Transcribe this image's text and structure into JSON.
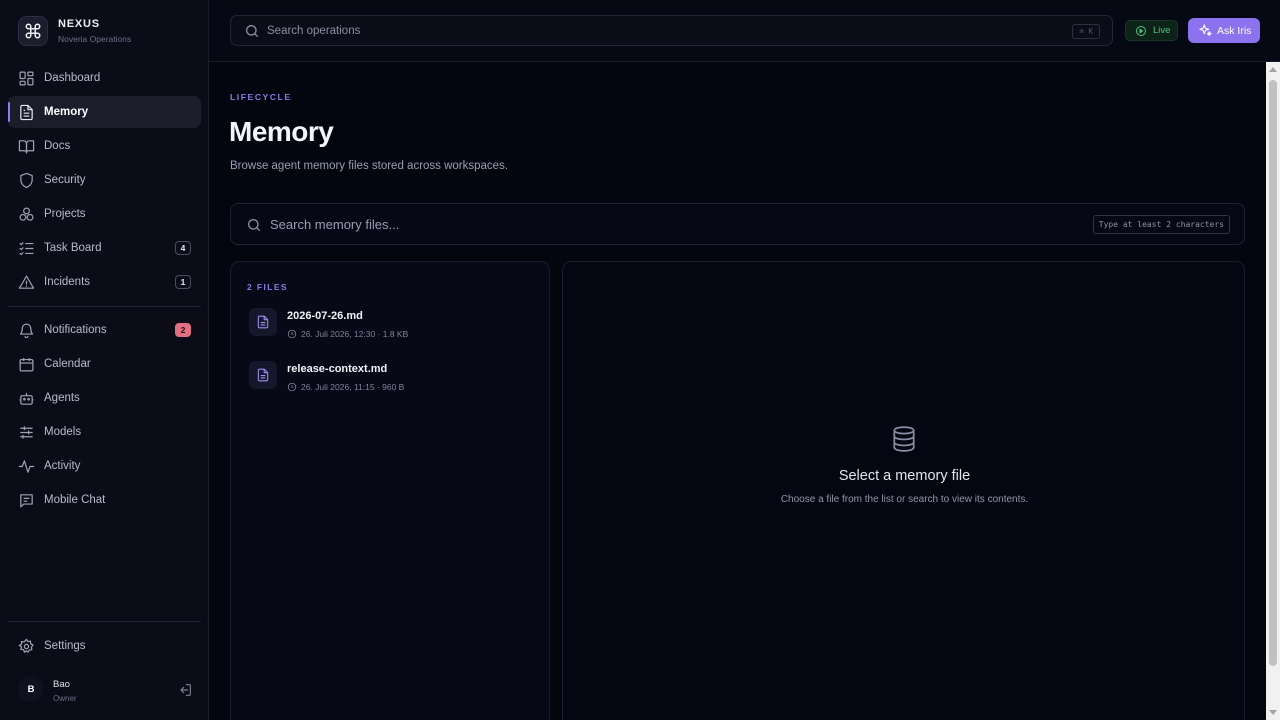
{
  "brand": {
    "name": "NEXUS",
    "subtitle": "Noveria Operations"
  },
  "nav": {
    "items": [
      {
        "label": "Dashboard",
        "icon": "dashboard-icon"
      },
      {
        "label": "Memory",
        "icon": "document-icon",
        "active": true
      },
      {
        "label": "Docs",
        "icon": "book-icon"
      },
      {
        "label": "Security",
        "icon": "shield-icon"
      },
      {
        "label": "Projects",
        "icon": "projects-icon"
      },
      {
        "label": "Task Board",
        "icon": "task-list-icon",
        "badge": "4"
      },
      {
        "label": "Incidents",
        "icon": "warning-icon",
        "badge": "1"
      },
      {
        "label": "Notifications",
        "icon": "bell-icon",
        "badge": "2"
      },
      {
        "label": "Calendar",
        "icon": "calendar-icon"
      },
      {
        "label": "Agents",
        "icon": "robot-icon"
      },
      {
        "label": "Models",
        "icon": "sliders-icon"
      },
      {
        "label": "Activity",
        "icon": "activity-icon"
      },
      {
        "label": "Mobile Chat",
        "icon": "chat-icon"
      }
    ],
    "settings": "Settings"
  },
  "user": {
    "initial": "B",
    "name": "Bao",
    "role": "Owner"
  },
  "topbar": {
    "search_placeholder": "Search operations",
    "shortcut": "⌘ K",
    "live_label": "Live",
    "ask_label": "Ask Iris"
  },
  "page": {
    "eyebrow": "LIFECYCLE",
    "title": "Memory",
    "subtitle": "Browse agent memory files stored across workspaces.",
    "search_placeholder": "Search memory files...",
    "search_hint": "Type at least 2 characters"
  },
  "files": {
    "count_label": "2 FILES",
    "items": [
      {
        "name": "2026-07-26.md",
        "meta": "26. Juli 2026, 12:30 · 1.8 KB"
      },
      {
        "name": "release-context.md",
        "meta": "26. Juli 2026, 11:15 · 960 B"
      }
    ]
  },
  "viewer": {
    "empty_title": "Select a memory file",
    "empty_subtitle": "Choose a file from the list or search to view its contents."
  },
  "colors": {
    "accent": "#8b73ef",
    "live": "#4ec07f",
    "notification_badge": "#e06f82",
    "background": "#03050f"
  }
}
